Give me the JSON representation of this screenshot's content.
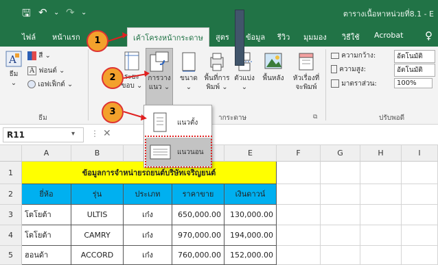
{
  "titlebar": {
    "save_icon": "save-icon",
    "undo_icon": "undo-icon",
    "redo_icon": "redo-icon",
    "title": "ตารางเนื้อหาหน่วยที่8.1 - E"
  },
  "tabs": [
    "ไฟล์",
    "หน้าแรก",
    "เค้าโครงหน้ากระดาษ",
    "สูตร",
    "ข้อมูล",
    "รีวิว",
    "มุมมอง",
    "วิธีใช้",
    "Acrobat"
  ],
  "ribbon": {
    "themes": {
      "label": "ธีม",
      "colors": "สี",
      "fonts": "ฟอนต์",
      "effects": "เอฟเฟ็กต์",
      "group": "ธีม"
    },
    "margins": "ระยะ\nขอบ",
    "orientation": "การวาง\nแนว",
    "size": "ขนาด",
    "print_area": "พื้นที่การ\nพิมพ์",
    "breaks": "ตัวแบ่ง",
    "background": "พื้นหลัง",
    "print_titles": "หัวเรื่องที่\nจะพิมพ์",
    "page_setup_group": "ตั้งค่าหน้ากระดาษ",
    "page_setup_group_visible": "ากระดาษ",
    "width_label": "ความกว้าง:",
    "width_value": "อัตโนมัติ",
    "height_label": "ความสูง:",
    "height_value": "อัตโนมัติ",
    "scale_label": "มาตราส่วน:",
    "scale_value": "100%",
    "scale_group": "ปรับพอดี"
  },
  "namebox": "R11",
  "orientation_menu": {
    "portrait": "แนวตั้ง",
    "landscape": "แนวนอน"
  },
  "callouts": [
    "1",
    "2",
    "3"
  ],
  "columns": [
    "A",
    "B",
    "C",
    "D",
    "E",
    "F",
    "G",
    "H",
    "I"
  ],
  "rows": [
    "1",
    "2",
    "3",
    "4",
    "5"
  ],
  "sheet": {
    "title": "ข้อมูลการจำหน่ายรถยนต์บริษัทเจริญยนต์",
    "headers": [
      "ยี่ห้อ",
      "รุ่น",
      "ประเภท",
      "ราคาขาย",
      "เงินดาวน์"
    ],
    "data": [
      [
        "โตโยต้า",
        "ULTIS",
        "เก๋ง",
        "650,000.00",
        "130,000.00"
      ],
      [
        "โตโยต้า",
        "CAMRY",
        "เก๋ง",
        "970,000.00",
        "194,000.00"
      ],
      [
        "ฮอนด้า",
        "ACCORD",
        "เก๋ง",
        "760,000.00",
        "152,000.00"
      ]
    ]
  },
  "colors": {
    "excel_green": "#217346",
    "title_yellow": "#ffff00",
    "header_cyan": "#00b0f0",
    "callout_orange": "#f3a12c",
    "callout_red": "#dd3333"
  }
}
